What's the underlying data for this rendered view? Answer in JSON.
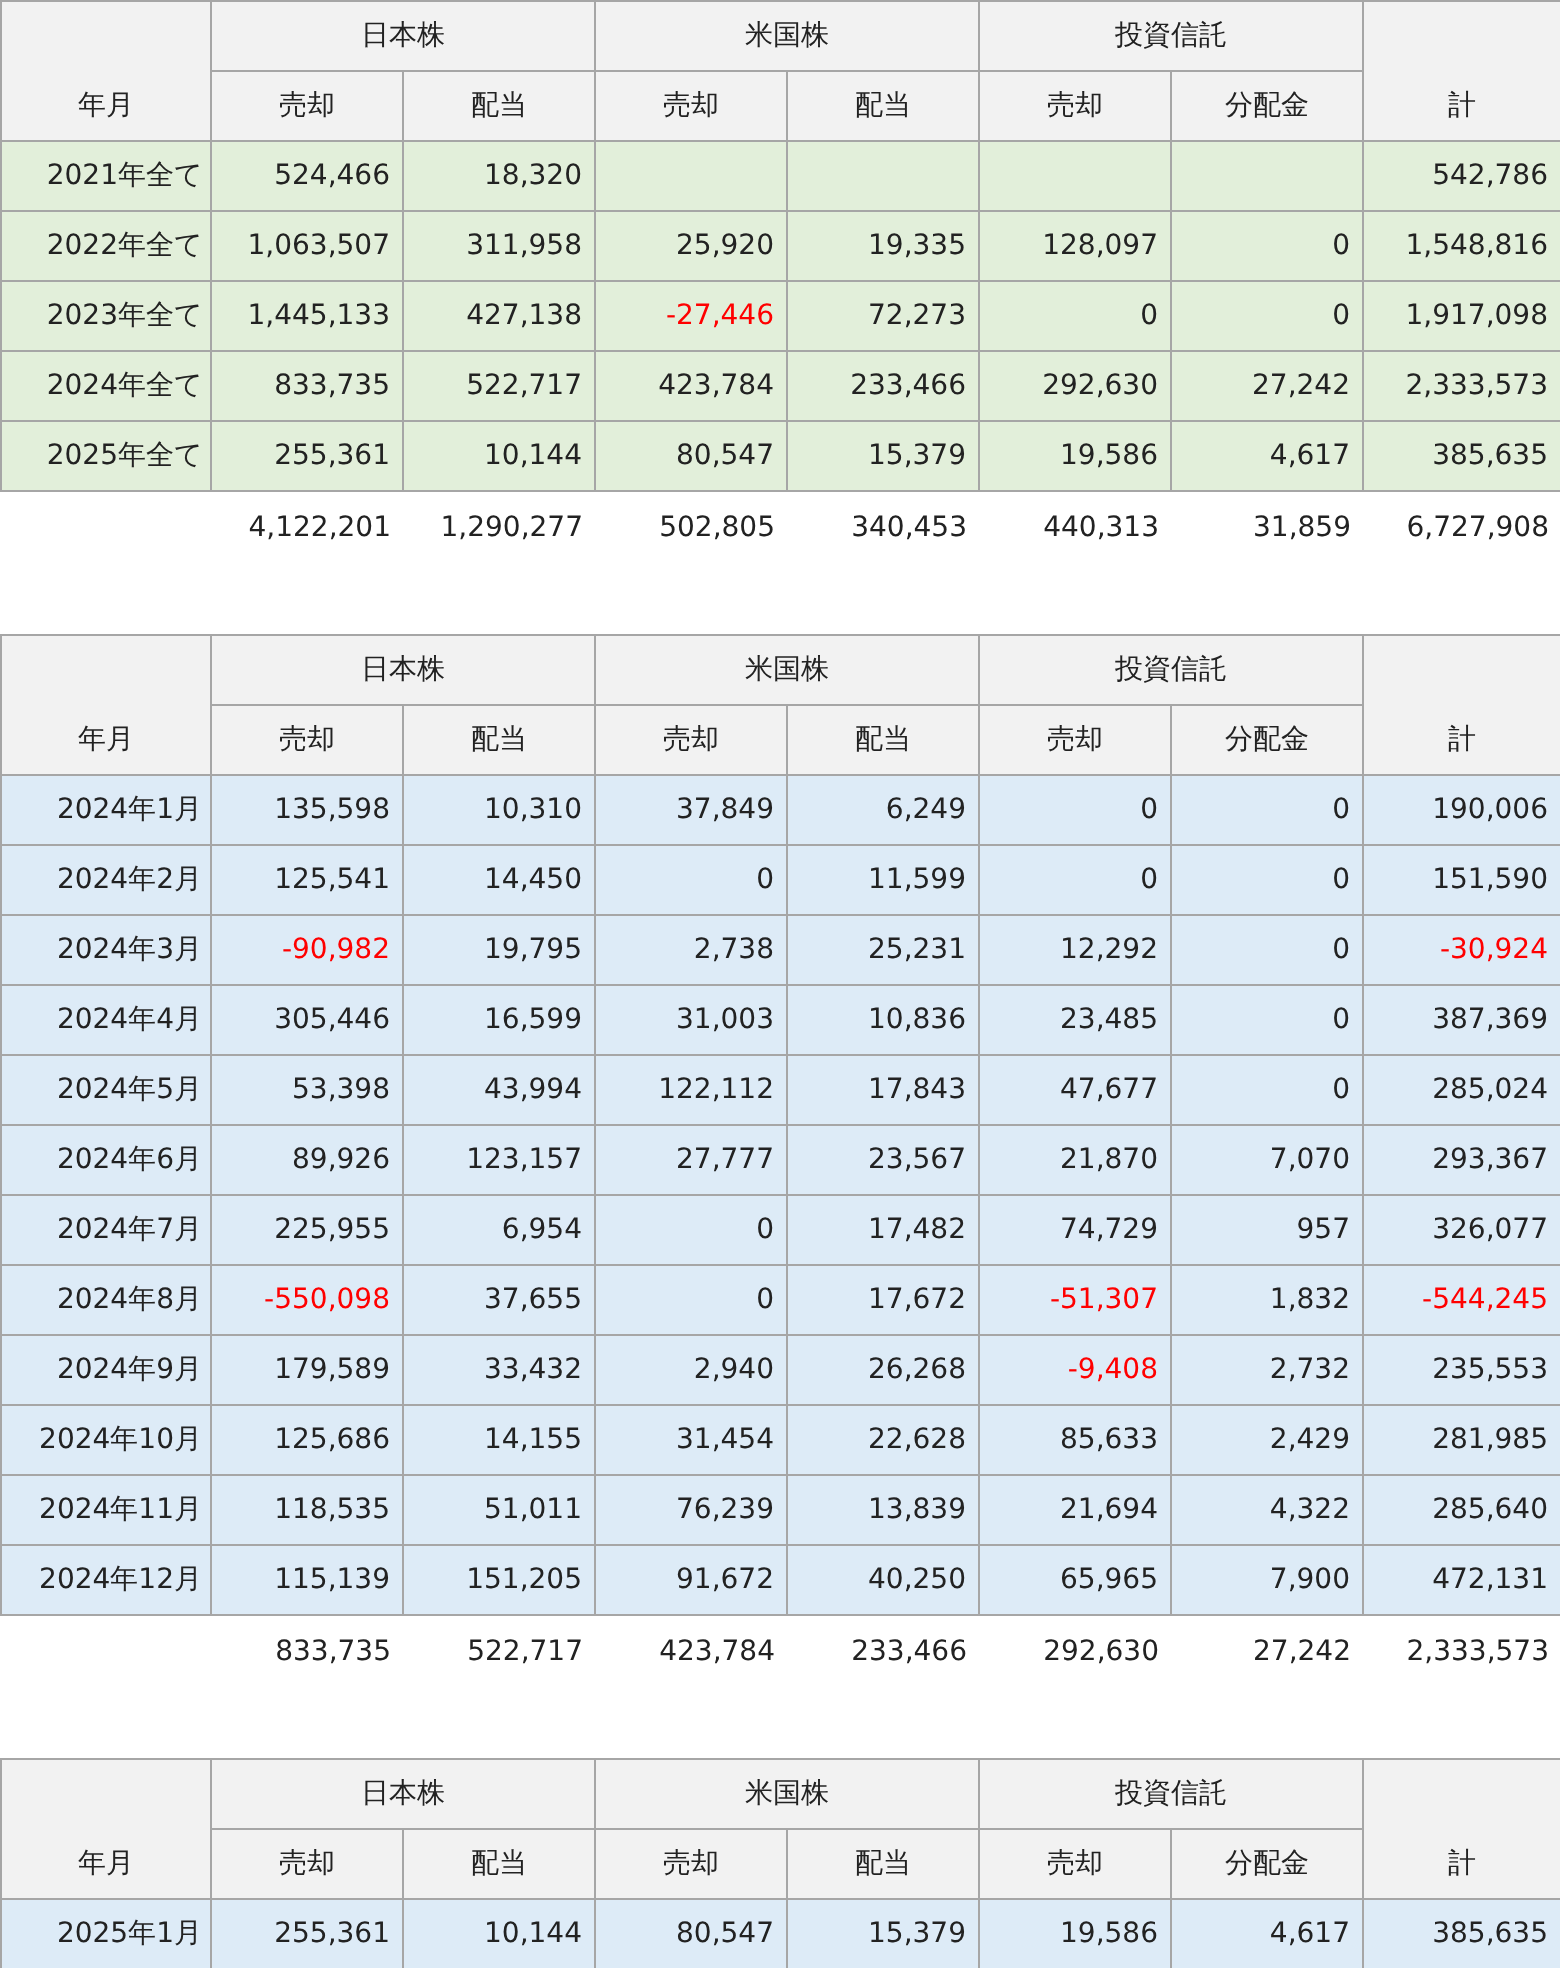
{
  "tables": [
    {
      "color": "#e2efda",
      "corner_label": "年月",
      "groups": [
        "日本株",
        "米国株",
        "投資信託"
      ],
      "total_label": "計",
      "subcolumns": [
        "売却",
        "配当",
        "売却",
        "配当",
        "売却",
        "分配金"
      ],
      "rows": [
        {
          "label": "2021年全て",
          "cells": [
            {
              "value": "524,466",
              "negative": false
            },
            {
              "value": "18,320",
              "negative": false
            },
            null,
            null,
            null,
            null,
            {
              "value": "542,786",
              "negative": false
            }
          ]
        },
        {
          "label": "2022年全て",
          "cells": [
            {
              "value": "1,063,507",
              "negative": false
            },
            {
              "value": "311,958",
              "negative": false
            },
            {
              "value": "25,920",
              "negative": false
            },
            {
              "value": "19,335",
              "negative": false
            },
            {
              "value": "128,097",
              "negative": false
            },
            {
              "value": "0",
              "negative": false
            },
            {
              "value": "1,548,816",
              "negative": false
            }
          ]
        },
        {
          "label": "2023年全て",
          "cells": [
            {
              "value": "1,445,133",
              "negative": false
            },
            {
              "value": "427,138",
              "negative": false
            },
            {
              "value": "-27,446",
              "negative": true
            },
            {
              "value": "72,273",
              "negative": false
            },
            {
              "value": "0",
              "negative": false
            },
            {
              "value": "0",
              "negative": false
            },
            {
              "value": "1,917,098",
              "negative": false
            }
          ]
        },
        {
          "label": "2024年全て",
          "cells": [
            {
              "value": "833,735",
              "negative": false
            },
            {
              "value": "522,717",
              "negative": false
            },
            {
              "value": "423,784",
              "negative": false
            },
            {
              "value": "233,466",
              "negative": false
            },
            {
              "value": "292,630",
              "negative": false
            },
            {
              "value": "27,242",
              "negative": false
            },
            {
              "value": "2,333,573",
              "negative": false
            }
          ]
        },
        {
          "label": "2025年全て",
          "cells": [
            {
              "value": "255,361",
              "negative": false
            },
            {
              "value": "10,144",
              "negative": false
            },
            {
              "value": "80,547",
              "negative": false
            },
            {
              "value": "15,379",
              "negative": false
            },
            {
              "value": "19,586",
              "negative": false
            },
            {
              "value": "4,617",
              "negative": false
            },
            {
              "value": "385,635",
              "negative": false
            }
          ]
        }
      ],
      "totals": [
        "4,122,201",
        "1,290,277",
        "502,805",
        "340,453",
        "440,313",
        "31,859",
        "6,727,908"
      ]
    },
    {
      "color": "#ddebf7",
      "corner_label": "年月",
      "groups": [
        "日本株",
        "米国株",
        "投資信託"
      ],
      "total_label": "計",
      "subcolumns": [
        "売却",
        "配当",
        "売却",
        "配当",
        "売却",
        "分配金"
      ],
      "rows": [
        {
          "label": "2024年1月",
          "cells": [
            {
              "value": "135,598",
              "negative": false
            },
            {
              "value": "10,310",
              "negative": false
            },
            {
              "value": "37,849",
              "negative": false
            },
            {
              "value": "6,249",
              "negative": false
            },
            {
              "value": "0",
              "negative": false
            },
            {
              "value": "0",
              "negative": false
            },
            {
              "value": "190,006",
              "negative": false
            }
          ]
        },
        {
          "label": "2024年2月",
          "cells": [
            {
              "value": "125,541",
              "negative": false
            },
            {
              "value": "14,450",
              "negative": false
            },
            {
              "value": "0",
              "negative": false
            },
            {
              "value": "11,599",
              "negative": false
            },
            {
              "value": "0",
              "negative": false
            },
            {
              "value": "0",
              "negative": false
            },
            {
              "value": "151,590",
              "negative": false
            }
          ]
        },
        {
          "label": "2024年3月",
          "cells": [
            {
              "value": "-90,982",
              "negative": true
            },
            {
              "value": "19,795",
              "negative": false
            },
            {
              "value": "2,738",
              "negative": false
            },
            {
              "value": "25,231",
              "negative": false
            },
            {
              "value": "12,292",
              "negative": false
            },
            {
              "value": "0",
              "negative": false
            },
            {
              "value": "-30,924",
              "negative": true
            }
          ]
        },
        {
          "label": "2024年4月",
          "cells": [
            {
              "value": "305,446",
              "negative": false
            },
            {
              "value": "16,599",
              "negative": false
            },
            {
              "value": "31,003",
              "negative": false
            },
            {
              "value": "10,836",
              "negative": false
            },
            {
              "value": "23,485",
              "negative": false
            },
            {
              "value": "0",
              "negative": false
            },
            {
              "value": "387,369",
              "negative": false
            }
          ]
        },
        {
          "label": "2024年5月",
          "cells": [
            {
              "value": "53,398",
              "negative": false
            },
            {
              "value": "43,994",
              "negative": false
            },
            {
              "value": "122,112",
              "negative": false
            },
            {
              "value": "17,843",
              "negative": false
            },
            {
              "value": "47,677",
              "negative": false
            },
            {
              "value": "0",
              "negative": false
            },
            {
              "value": "285,024",
              "negative": false
            }
          ]
        },
        {
          "label": "2024年6月",
          "cells": [
            {
              "value": "89,926",
              "negative": false
            },
            {
              "value": "123,157",
              "negative": false
            },
            {
              "value": "27,777",
              "negative": false
            },
            {
              "value": "23,567",
              "negative": false
            },
            {
              "value": "21,870",
              "negative": false
            },
            {
              "value": "7,070",
              "negative": false
            },
            {
              "value": "293,367",
              "negative": false
            }
          ]
        },
        {
          "label": "2024年7月",
          "cells": [
            {
              "value": "225,955",
              "negative": false
            },
            {
              "value": "6,954",
              "negative": false
            },
            {
              "value": "0",
              "negative": false
            },
            {
              "value": "17,482",
              "negative": false
            },
            {
              "value": "74,729",
              "negative": false
            },
            {
              "value": "957",
              "negative": false
            },
            {
              "value": "326,077",
              "negative": false
            }
          ]
        },
        {
          "label": "2024年8月",
          "cells": [
            {
              "value": "-550,098",
              "negative": true
            },
            {
              "value": "37,655",
              "negative": false
            },
            {
              "value": "0",
              "negative": false
            },
            {
              "value": "17,672",
              "negative": false
            },
            {
              "value": "-51,307",
              "negative": true
            },
            {
              "value": "1,832",
              "negative": false
            },
            {
              "value": "-544,245",
              "negative": true
            }
          ]
        },
        {
          "label": "2024年9月",
          "cells": [
            {
              "value": "179,589",
              "negative": false
            },
            {
              "value": "33,432",
              "negative": false
            },
            {
              "value": "2,940",
              "negative": false
            },
            {
              "value": "26,268",
              "negative": false
            },
            {
              "value": "-9,408",
              "negative": true
            },
            {
              "value": "2,732",
              "negative": false
            },
            {
              "value": "235,553",
              "negative": false
            }
          ]
        },
        {
          "label": "2024年10月",
          "cells": [
            {
              "value": "125,686",
              "negative": false
            },
            {
              "value": "14,155",
              "negative": false
            },
            {
              "value": "31,454",
              "negative": false
            },
            {
              "value": "22,628",
              "negative": false
            },
            {
              "value": "85,633",
              "negative": false
            },
            {
              "value": "2,429",
              "negative": false
            },
            {
              "value": "281,985",
              "negative": false
            }
          ]
        },
        {
          "label": "2024年11月",
          "cells": [
            {
              "value": "118,535",
              "negative": false
            },
            {
              "value": "51,011",
              "negative": false
            },
            {
              "value": "76,239",
              "negative": false
            },
            {
              "value": "13,839",
              "negative": false
            },
            {
              "value": "21,694",
              "negative": false
            },
            {
              "value": "4,322",
              "negative": false
            },
            {
              "value": "285,640",
              "negative": false
            }
          ]
        },
        {
          "label": "2024年12月",
          "cells": [
            {
              "value": "115,139",
              "negative": false
            },
            {
              "value": "151,205",
              "negative": false
            },
            {
              "value": "91,672",
              "negative": false
            },
            {
              "value": "40,250",
              "negative": false
            },
            {
              "value": "65,965",
              "negative": false
            },
            {
              "value": "7,900",
              "negative": false
            },
            {
              "value": "472,131",
              "negative": false
            }
          ]
        }
      ],
      "totals": [
        "833,735",
        "522,717",
        "423,784",
        "233,466",
        "292,630",
        "27,242",
        "2,333,573"
      ]
    },
    {
      "color": "#ddebf7",
      "corner_label": "年月",
      "groups": [
        "日本株",
        "米国株",
        "投資信託"
      ],
      "total_label": "計",
      "subcolumns": [
        "売却",
        "配当",
        "売却",
        "配当",
        "売却",
        "分配金"
      ],
      "rows": [
        {
          "label": "2025年1月",
          "cells": [
            {
              "value": "255,361",
              "negative": false
            },
            {
              "value": "10,144",
              "negative": false
            },
            {
              "value": "80,547",
              "negative": false
            },
            {
              "value": "15,379",
              "negative": false
            },
            {
              "value": "19,586",
              "negative": false
            },
            {
              "value": "4,617",
              "negative": false
            },
            {
              "value": "385,635",
              "negative": false
            }
          ]
        }
      ]
    }
  ]
}
